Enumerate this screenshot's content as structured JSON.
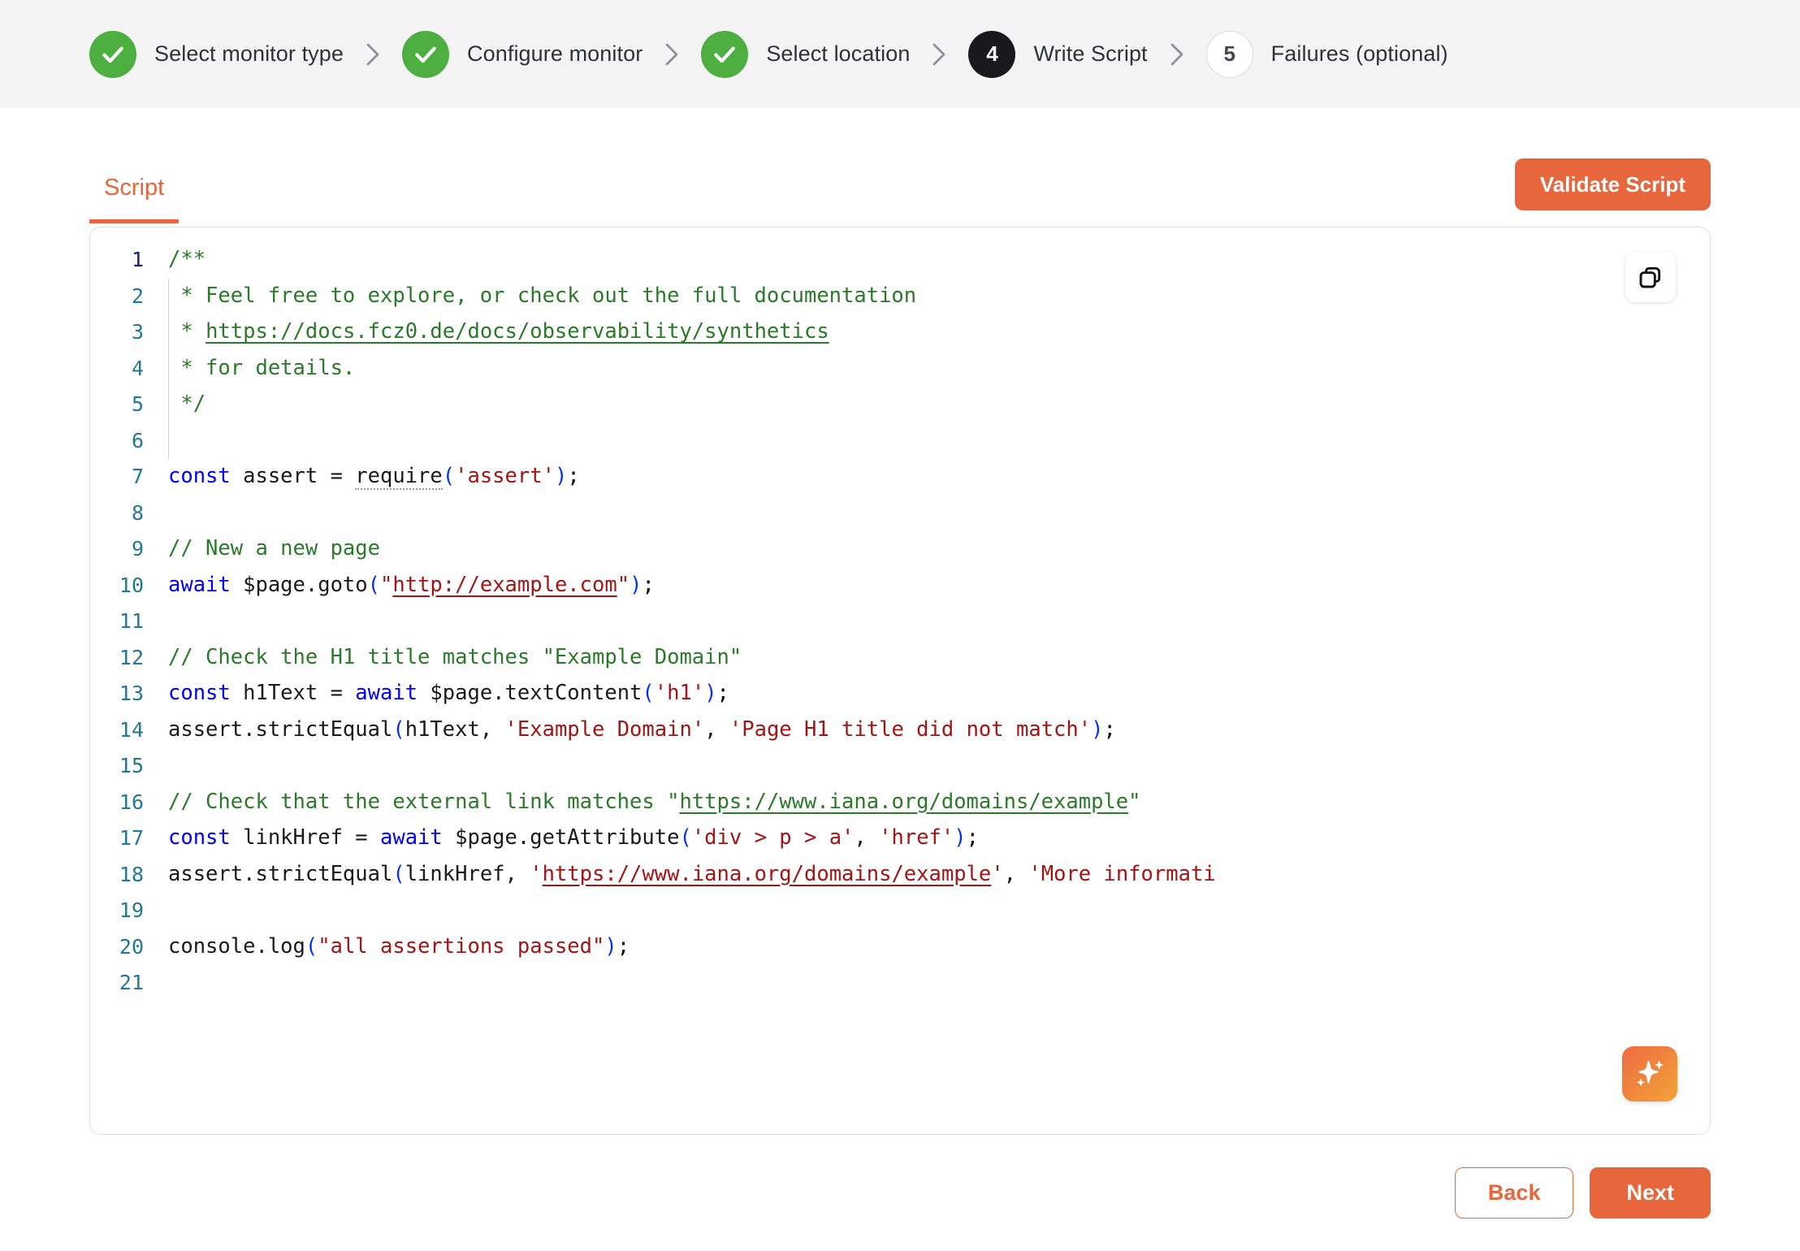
{
  "stepper": {
    "steps": [
      {
        "label": "Select monitor type",
        "marker": "check",
        "state": "done"
      },
      {
        "label": "Configure monitor",
        "marker": "check",
        "state": "done"
      },
      {
        "label": "Select location",
        "marker": "check",
        "state": "done"
      },
      {
        "label": "Write Script",
        "marker": "4",
        "state": "current"
      },
      {
        "label": "Failures (optional)",
        "marker": "5",
        "state": "upcoming"
      }
    ],
    "separator": "chevron-right-icon"
  },
  "panel": {
    "tabs": [
      {
        "label": "Script",
        "active": true
      }
    ],
    "validate_label": "Validate Script"
  },
  "editor": {
    "copy_icon": "copy-icon",
    "ai_icon": "sparkle-icon",
    "language": "javascript",
    "line_count": 21,
    "lines": [
      {
        "n": 1,
        "indent_guide": false,
        "text": "/**"
      },
      {
        "n": 2,
        "indent_guide": true,
        "text": " * Feel free to explore, or check out the full documentation"
      },
      {
        "n": 3,
        "indent_guide": true,
        "text": " * https://docs.fcz0.de/docs/observability/synthetics"
      },
      {
        "n": 4,
        "indent_guide": true,
        "text": " * for details."
      },
      {
        "n": 5,
        "indent_guide": true,
        "text": " */"
      },
      {
        "n": 6,
        "indent_guide": false,
        "text": ""
      },
      {
        "n": 7,
        "indent_guide": false,
        "text": "const assert = require('assert');"
      },
      {
        "n": 8,
        "indent_guide": false,
        "text": ""
      },
      {
        "n": 9,
        "indent_guide": false,
        "text": "// New a new page"
      },
      {
        "n": 10,
        "indent_guide": false,
        "text": "await $page.goto(\"http://example.com\");"
      },
      {
        "n": 11,
        "indent_guide": false,
        "text": ""
      },
      {
        "n": 12,
        "indent_guide": false,
        "text": "// Check the H1 title matches \"Example Domain\""
      },
      {
        "n": 13,
        "indent_guide": false,
        "text": "const h1Text = await $page.textContent('h1');"
      },
      {
        "n": 14,
        "indent_guide": false,
        "text": "assert.strictEqual(h1Text, 'Example Domain', 'Page H1 title did not match');"
      },
      {
        "n": 15,
        "indent_guide": false,
        "text": ""
      },
      {
        "n": 16,
        "indent_guide": false,
        "text": "// Check that the external link matches \"https://www.iana.org/domains/example\""
      },
      {
        "n": 17,
        "indent_guide": false,
        "text": "const linkHref = await $page.getAttribute('div > p > a', 'href');"
      },
      {
        "n": 18,
        "indent_guide": false,
        "text": "assert.strictEqual(linkHref, 'https://www.iana.org/domains/example', 'More informati"
      },
      {
        "n": 19,
        "indent_guide": false,
        "text": ""
      },
      {
        "n": 20,
        "indent_guide": false,
        "text": "console.log(\"all assertions passed\");"
      },
      {
        "n": 21,
        "indent_guide": false,
        "text": ""
      }
    ],
    "doc_url": "https://docs.fcz0.de/docs/observability/synthetics",
    "goto_url": "http://example.com",
    "iana_url": "https://www.iana.org/domains/example"
  },
  "footer": {
    "back_label": "Back",
    "next_label": "Next"
  },
  "colors": {
    "accent": "#e8663c",
    "done": "#4caf3f",
    "current": "#17191c",
    "header_bg": "#f4f4f4",
    "line_number": "#237893",
    "comment": "#2a7a2a",
    "keyword": "#0000ff",
    "string": "#a31515"
  }
}
